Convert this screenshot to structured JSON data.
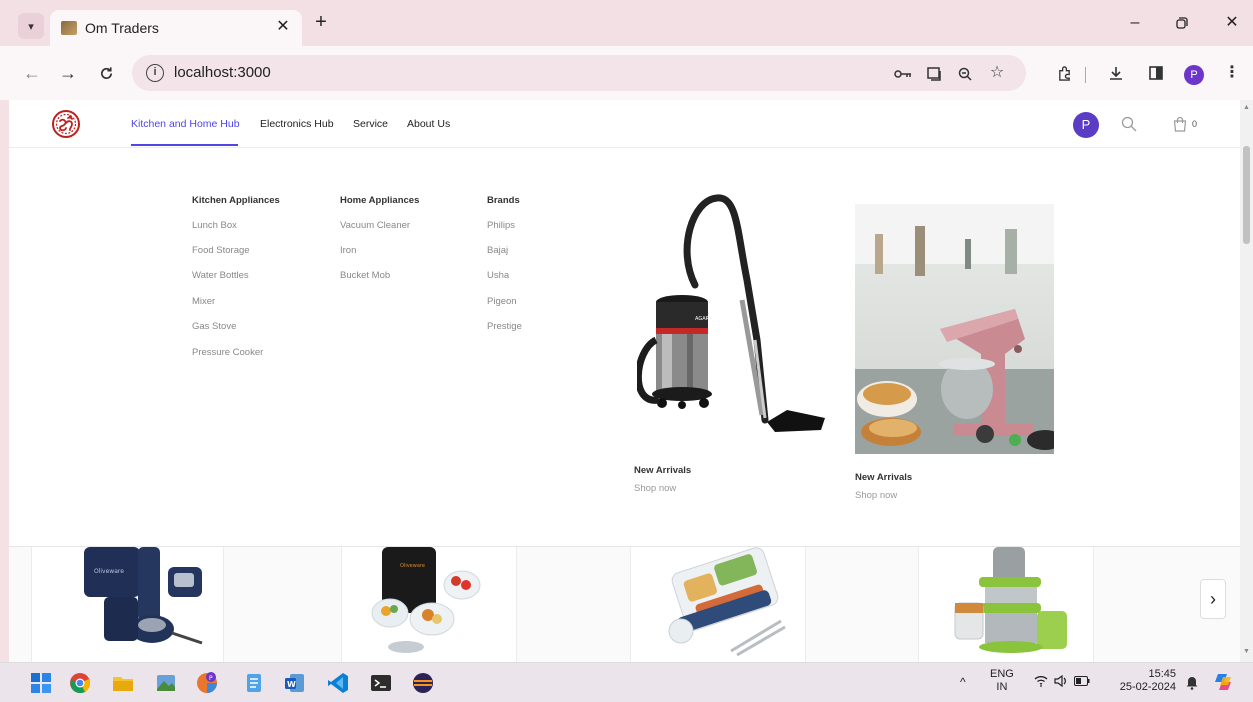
{
  "browser": {
    "tab_title": "Om Traders",
    "url": "localhost:3000",
    "profile_initial": "P"
  },
  "site": {
    "nav": [
      "Kitchen and Home Hub",
      "Electronics Hub",
      "Service",
      "About Us"
    ],
    "user_initial": "P",
    "cart_count": "0",
    "accent_color": "#4f46e5"
  },
  "menu": {
    "columns": [
      {
        "title": "Kitchen Appliances",
        "items": [
          "Lunch Box",
          "Food Storage",
          "Water Bottles",
          "Mixer",
          "Gas Stove",
          "Pressure Cooker"
        ]
      },
      {
        "title": "Home Appliances",
        "items": [
          "Vacuum Cleaner",
          "Iron",
          "Bucket Mob"
        ]
      },
      {
        "title": "Brands",
        "items": [
          "Philips",
          "Bajaj",
          "Usha",
          "Pigeon",
          "Prestige"
        ]
      }
    ],
    "promos": [
      {
        "title": "New Arrivals",
        "link": "Shop now",
        "image_brand": "AGARO"
      },
      {
        "title": "New Arrivals",
        "link": "Shop now"
      }
    ]
  },
  "product_strip": {
    "brand_marks": [
      "Oliveware",
      "Oliveware"
    ]
  },
  "taskbar": {
    "lang_top": "ENG",
    "lang_bottom": "IN",
    "time": "15:45",
    "date": "25-02-2024"
  }
}
